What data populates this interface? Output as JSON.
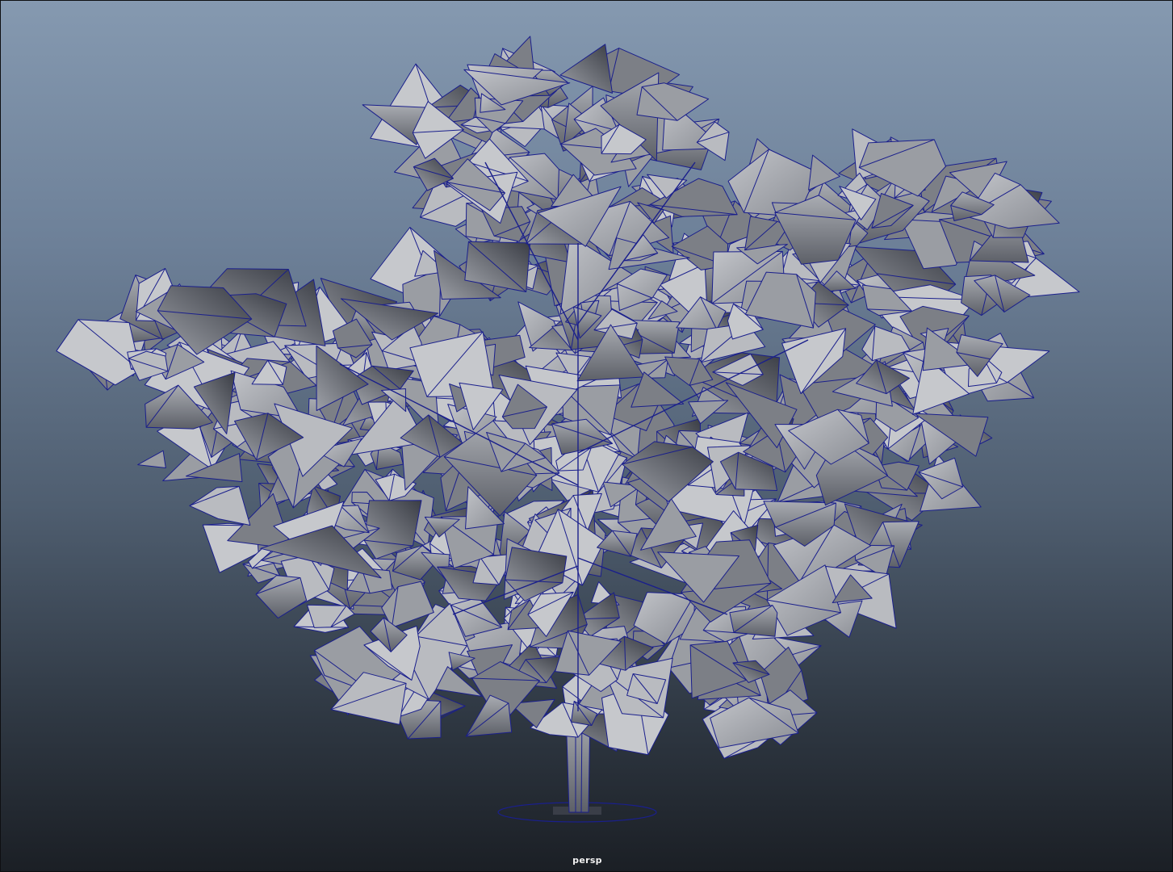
{
  "viewport": {
    "camera_label": "persp",
    "background_top": "#8599b0",
    "background_bottom": "#1b1f25",
    "wireframe_color": "#1a1f8c",
    "mesh_shade_light": "#b6b8bd",
    "mesh_shade_mid": "#8f9298",
    "mesh_shade_dark": "#2c2f36"
  },
  "scene": {
    "object": "tree-mesh",
    "display_mode": "wireframe-on-shaded"
  }
}
